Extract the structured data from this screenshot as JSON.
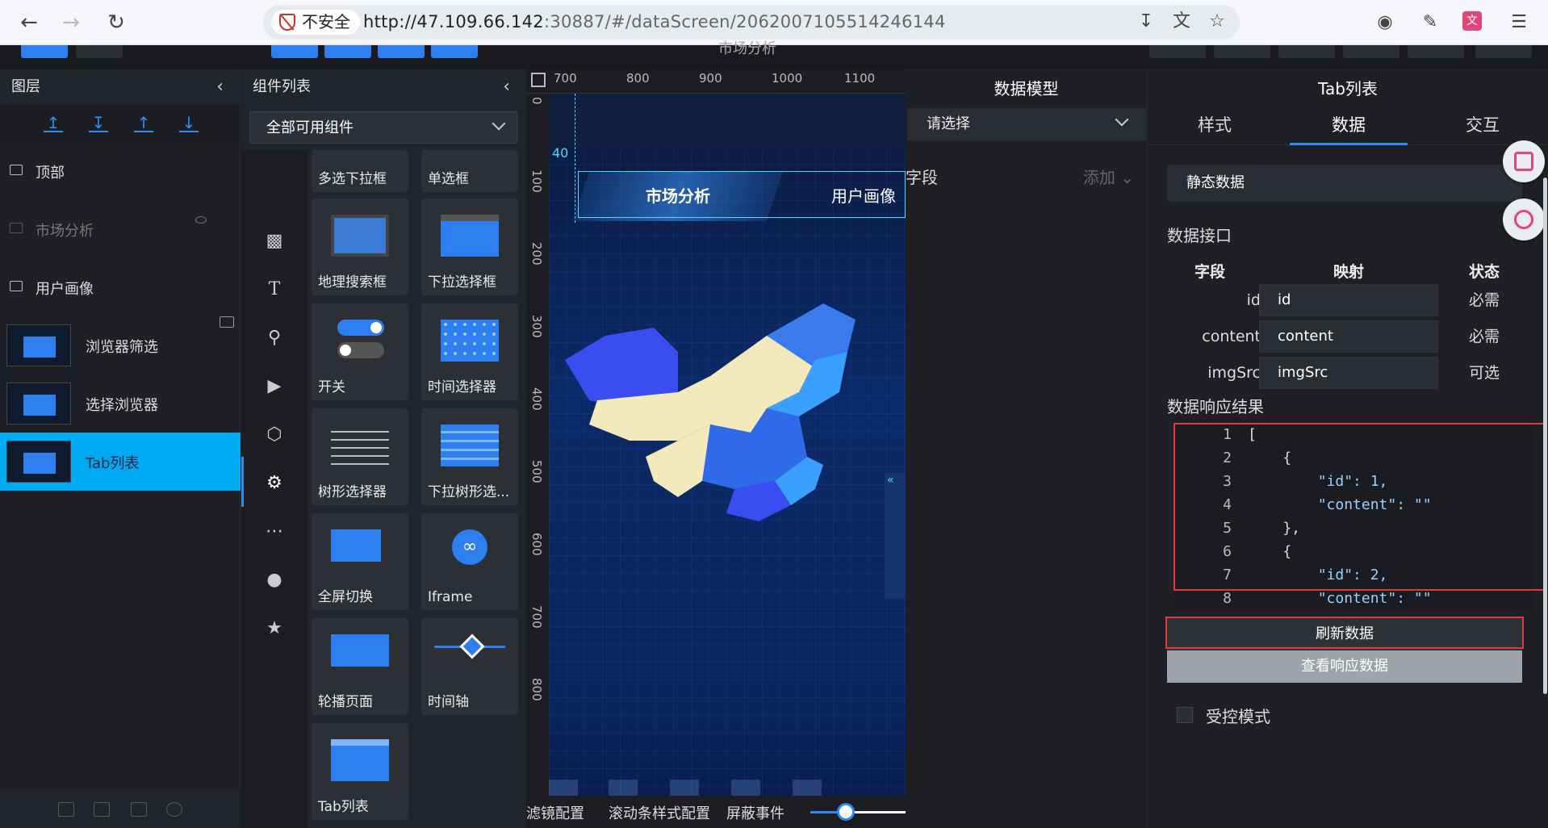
{
  "browser": {
    "insecure_label": "不安全",
    "url_host": "http://47.109.66.142",
    "url_rest": ":30887/#/dataScreen/2062007105514246144"
  },
  "editor": {
    "screen_title": "市场分析"
  },
  "layers": {
    "title": "图层",
    "items": [
      {
        "label": "顶部",
        "type": "folder"
      },
      {
        "label": "市场分析",
        "type": "folder"
      },
      {
        "label": "用户画像",
        "type": "folder"
      },
      {
        "label": "浏览器筛选",
        "type": "component"
      },
      {
        "label": "选择浏览器",
        "type": "component"
      },
      {
        "label": "Tab列表",
        "type": "component"
      }
    ]
  },
  "components": {
    "title": "组件列表",
    "filter_value": "全部可用组件",
    "cards": [
      "多选下拉框",
      "单选框",
      "地理搜索框",
      "下拉选择框",
      "开关",
      "时间选择器",
      "树形选择器",
      "下拉树形选...",
      "全屏切换",
      "Iframe",
      "轮播页面",
      "时间轴",
      "Tab列表"
    ]
  },
  "canvas": {
    "ruler_x": [
      "700",
      "800",
      "900",
      "1000",
      "1100"
    ],
    "ruler_y": [
      "0",
      "100",
      "200",
      "300",
      "400",
      "500",
      "600",
      "700",
      "800"
    ],
    "offset_label": "40",
    "tab_active": "市场分析",
    "tab_inactive": "用户画像",
    "bar_levels": [
      0.4,
      0,
      0.12,
      0,
      0.22
    ],
    "bottom_tabs": [
      "滤镜配置",
      "滚动条样式配置",
      "屏蔽事件"
    ],
    "zoom_level": 0.37
  },
  "model": {
    "title": "数据模型",
    "placeholder": "请选择",
    "field_label": "字段",
    "add_label": "添加"
  },
  "props": {
    "title": "Tab列表",
    "tabs": [
      "样式",
      "数据",
      "交互"
    ],
    "source": "静态数据",
    "interface_label": "数据接口",
    "col_field": "字段",
    "col_map": "映射",
    "col_status": "状态",
    "rows": [
      {
        "field": "id",
        "map": "id",
        "status": "必需"
      },
      {
        "field": "content",
        "map": "content",
        "status": "必需"
      },
      {
        "field": "imgSrc",
        "map": "imgSrc",
        "status": "可选"
      }
    ],
    "result_label": "数据响应结果",
    "code_lines": [
      "[",
      "    {",
      "        \"id\": 1,",
      "        \"content\": \"\"",
      "    },",
      "    {",
      "        \"id\": 2,",
      "        \"content\": \"\""
    ],
    "refresh_label": "刷新数据",
    "view_label": "查看响应数据",
    "controlled_label": "受控模式"
  }
}
